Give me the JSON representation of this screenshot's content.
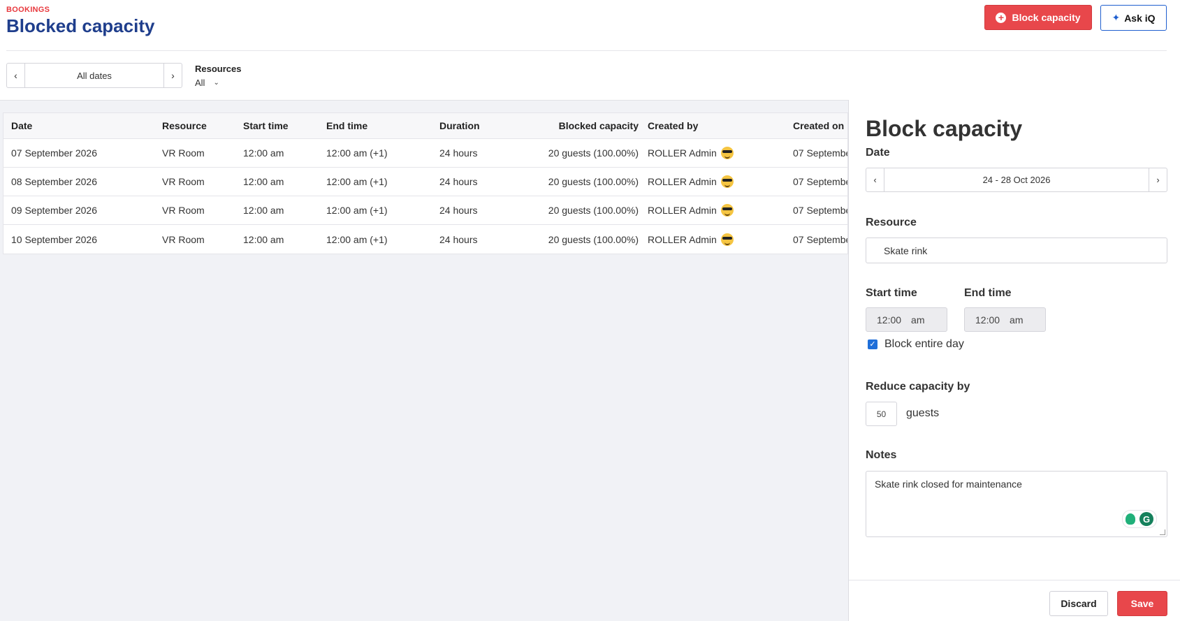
{
  "header": {
    "eyebrow": "BOOKINGS",
    "title": "Blocked capacity",
    "block_button": "Block capacity",
    "ask_button": "Ask iQ"
  },
  "filters": {
    "date_value": "All dates",
    "resources_label": "Resources",
    "resources_value": "All"
  },
  "table": {
    "columns": [
      "Date",
      "Resource",
      "Start time",
      "End time",
      "Duration",
      "Blocked capacity",
      "Created by",
      "Created on"
    ],
    "rows": [
      {
        "date": "07 September 2026",
        "resource": "VR Room",
        "start": "12:00 am",
        "end": "12:00 am (+1)",
        "duration": "24 hours",
        "blocked": "20 guests (100.00%)",
        "created_by": "ROLLER Admin",
        "created_on": "07 Septembe"
      },
      {
        "date": "08 September 2026",
        "resource": "VR Room",
        "start": "12:00 am",
        "end": "12:00 am (+1)",
        "duration": "24 hours",
        "blocked": "20 guests (100.00%)",
        "created_by": "ROLLER Admin",
        "created_on": "07 Septembe"
      },
      {
        "date": "09 September 2026",
        "resource": "VR Room",
        "start": "12:00 am",
        "end": "12:00 am (+1)",
        "duration": "24 hours",
        "blocked": "20 guests (100.00%)",
        "created_by": "ROLLER Admin",
        "created_on": "07 Septembe"
      },
      {
        "date": "10 September 2026",
        "resource": "VR Room",
        "start": "12:00 am",
        "end": "12:00 am (+1)",
        "duration": "24 hours",
        "blocked": "20 guests (100.00%)",
        "created_by": "ROLLER Admin",
        "created_on": "07 Septembe"
      }
    ]
  },
  "panel": {
    "title": "Block capacity",
    "date_label": "Date",
    "date_value": "24 - 28 Oct 2026",
    "resource_label": "Resource",
    "resource_value": "Skate rink",
    "start_label": "Start time",
    "start_time": "12:00",
    "start_ampm": "am",
    "end_label": "End time",
    "end_time": "12:00",
    "end_ampm": "am",
    "block_day_label": "Block entire day",
    "block_day_checked": true,
    "reduce_label": "Reduce capacity by",
    "reduce_value": "50",
    "reduce_unit": "guests",
    "notes_label": "Notes",
    "notes_value": "Skate rink closed for maintenance",
    "discard_button": "Discard",
    "save_button": "Save"
  },
  "colors": {
    "accent_red": "#e8474b",
    "title_blue": "#1f3e8c",
    "checkbox_blue": "#1f6fd9"
  }
}
